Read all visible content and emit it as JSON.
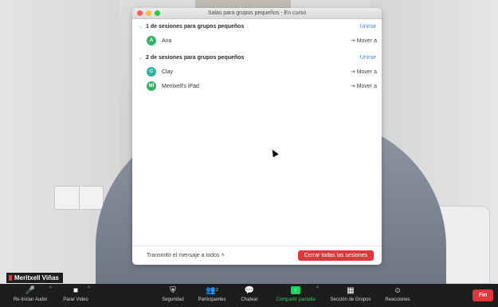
{
  "window": {
    "title": "Salas para grupos pequeños - En curso"
  },
  "rooms": [
    {
      "title": "1 de sesiones para grupos pequeños",
      "join_label": "Unirse",
      "members": [
        {
          "initial": "A",
          "name": "Ana",
          "move_label": "Mover a",
          "avatar_color": "#35b26a"
        }
      ]
    },
    {
      "title": "2 de sesiones para grupos pequeños",
      "join_label": "Unirse",
      "members": [
        {
          "initial": "C",
          "name": "Clay",
          "move_label": "Mover a",
          "avatar_color": "#2fb3a5"
        },
        {
          "initial": "MI",
          "name": "Meritxell's iPad",
          "move_label": "Mover a",
          "avatar_color": "#35b26a"
        }
      ]
    }
  ],
  "footer": {
    "broadcast_label": "Transmitir el mensaje a todos",
    "close_all_label": "Cerrar todas las sesiones"
  },
  "name_tag": "Meritxell Viñas",
  "toolbar": {
    "items": [
      {
        "label": "Re-Iniciar Audio",
        "icon": "microphone-muted-icon"
      },
      {
        "label": "Parar Video",
        "icon": "video-camera-icon"
      },
      {
        "label": "Seguridad",
        "icon": "shield-icon"
      },
      {
        "label": "Participantes",
        "icon": "participants-icon",
        "count": "3"
      },
      {
        "label": "Chatear",
        "icon": "chat-bubble-icon"
      },
      {
        "label": "Compartir pantalla",
        "icon": "share-screen-icon"
      },
      {
        "label": "Sección de Grupos",
        "icon": "breakout-rooms-icon"
      },
      {
        "label": "Reacciones",
        "icon": "reactions-icon"
      }
    ],
    "end_label": "Fin"
  },
  "colors": {
    "accent_blue": "#2d8cff",
    "danger_red": "#e0363c",
    "share_green": "#23d160",
    "toolbar_bg": "#1d1d1d"
  }
}
